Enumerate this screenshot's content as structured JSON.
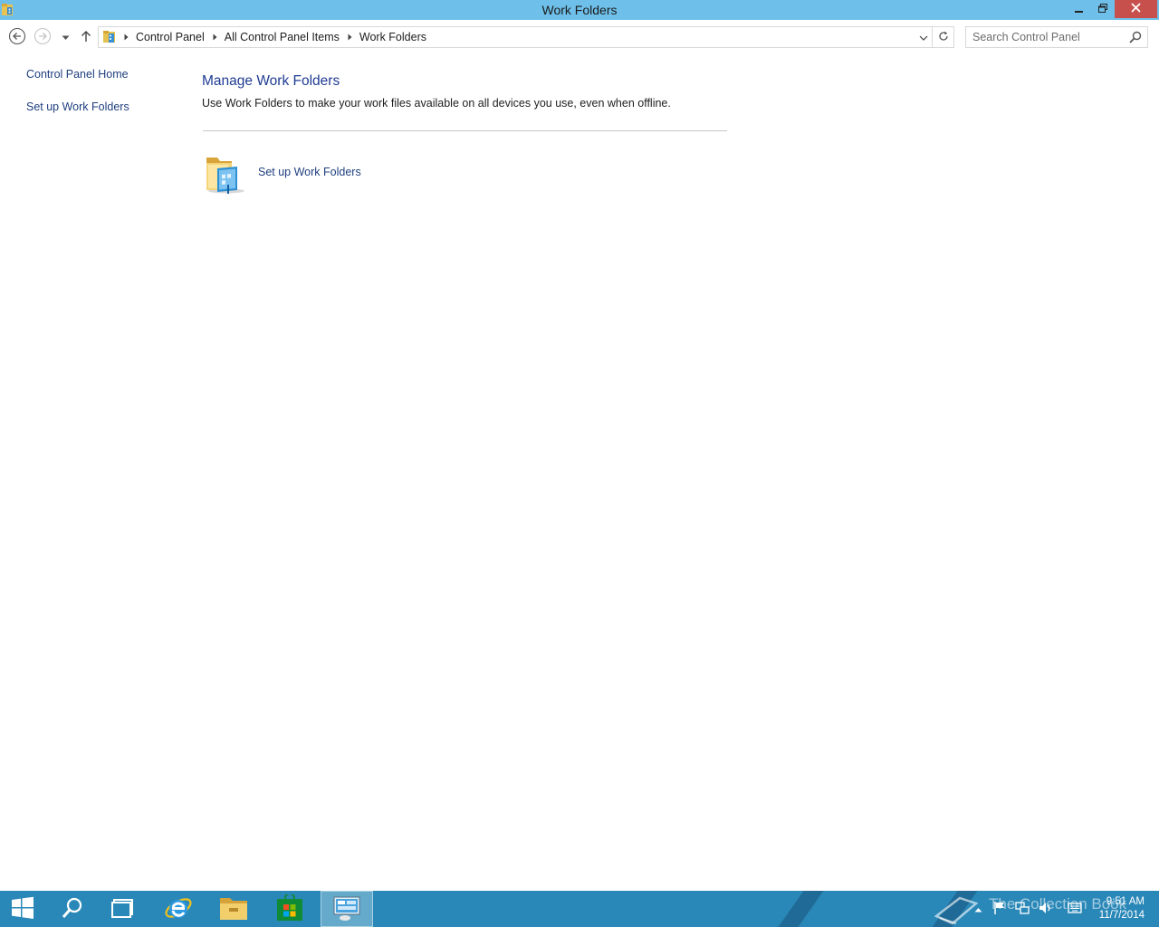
{
  "window": {
    "title": "Work Folders"
  },
  "address": {
    "crumbs": [
      "Control Panel",
      "All Control Panel Items",
      "Work Folders"
    ]
  },
  "search": {
    "placeholder": "Search Control Panel"
  },
  "sidebar": {
    "items": [
      {
        "label": "Control Panel Home"
      },
      {
        "label": "Set up Work Folders"
      }
    ]
  },
  "main": {
    "heading": "Manage Work Folders",
    "description": "Use Work Folders to make your work files available on all devices you use, even when offline.",
    "task_label": "Set up Work Folders"
  },
  "taskbar": {
    "clock_time": "9:51 AM",
    "clock_date": "11/7/2014",
    "watermark": "The Collection Book"
  },
  "colors": {
    "titlebar": "#6ec0ea",
    "close_button": "#c7504c",
    "link": "#1f3f7f",
    "heading": "#1e3b93",
    "taskbar": "#2a88b8"
  }
}
